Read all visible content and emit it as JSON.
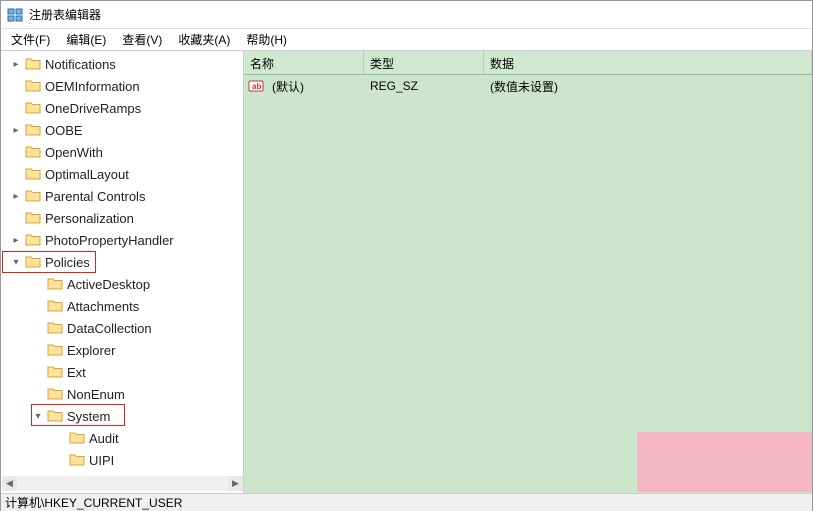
{
  "window": {
    "title": "注册表编辑器"
  },
  "menubar": {
    "items": [
      {
        "label": "文件(F)"
      },
      {
        "label": "编辑(E)"
      },
      {
        "label": "查看(V)"
      },
      {
        "label": "收藏夹(A)"
      },
      {
        "label": "帮助(H)"
      }
    ]
  },
  "tree": {
    "items": [
      {
        "label": "Notifications",
        "expander": "right",
        "indent": 0
      },
      {
        "label": "OEMInformation",
        "expander": "none",
        "indent": 0
      },
      {
        "label": "OneDriveRamps",
        "expander": "none",
        "indent": 0
      },
      {
        "label": "OOBE",
        "expander": "right",
        "indent": 0
      },
      {
        "label": "OpenWith",
        "expander": "none",
        "indent": 0
      },
      {
        "label": "OptimalLayout",
        "expander": "none",
        "indent": 0
      },
      {
        "label": "Parental Controls",
        "expander": "right",
        "indent": 0
      },
      {
        "label": "Personalization",
        "expander": "none",
        "indent": 0
      },
      {
        "label": "PhotoPropertyHandler",
        "expander": "right",
        "indent": 0
      },
      {
        "label": "Policies",
        "expander": "down",
        "indent": 0
      },
      {
        "label": "ActiveDesktop",
        "expander": "none",
        "indent": 1
      },
      {
        "label": "Attachments",
        "expander": "none",
        "indent": 1
      },
      {
        "label": "DataCollection",
        "expander": "none",
        "indent": 1
      },
      {
        "label": "Explorer",
        "expander": "none",
        "indent": 1
      },
      {
        "label": "Ext",
        "expander": "none",
        "indent": 1
      },
      {
        "label": "NonEnum",
        "expander": "none",
        "indent": 1
      },
      {
        "label": "System",
        "expander": "down",
        "indent": 1
      },
      {
        "label": "Audit",
        "expander": "none",
        "indent": 2
      },
      {
        "label": "UIPI",
        "expander": "none",
        "indent": 2
      }
    ]
  },
  "list": {
    "columns": {
      "name": "名称",
      "type": "类型",
      "data": "数据"
    },
    "rows": [
      {
        "name": "(默认)",
        "type": "REG_SZ",
        "data": "(数值未设置)"
      }
    ]
  },
  "statusbar": {
    "path": "计算机\\HKEY_CURRENT_USER"
  }
}
